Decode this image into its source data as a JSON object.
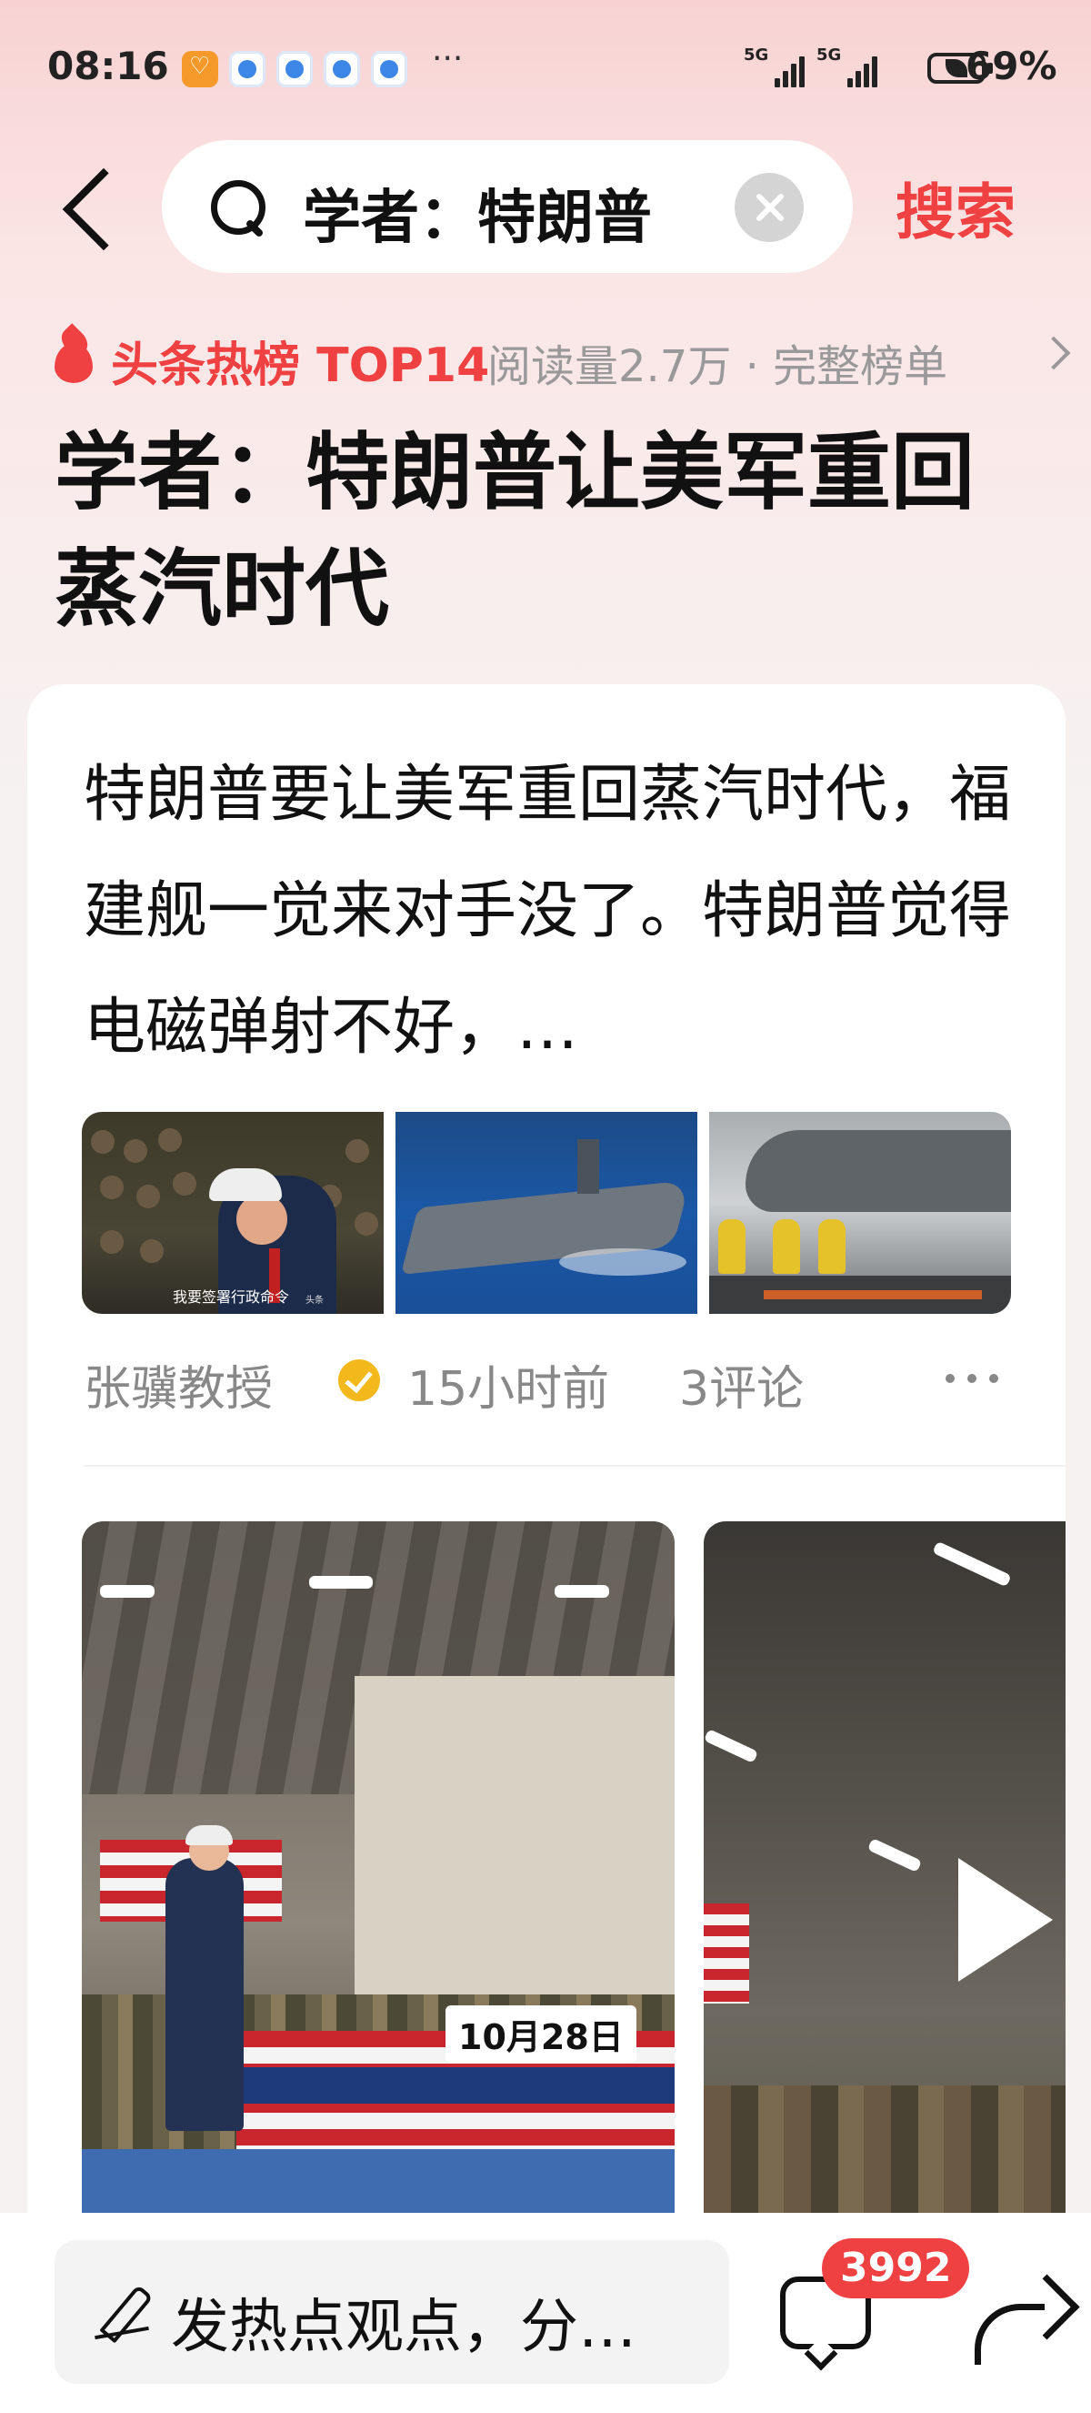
{
  "status_bar": {
    "time": "08:16",
    "network_1": "5G",
    "network_2": "5G",
    "battery_percent": "69%",
    "more": "···"
  },
  "search": {
    "query": "学者：特朗普",
    "button_label": "搜索"
  },
  "hot_list": {
    "badge": "头条热榜 TOP14",
    "meta": "阅读量2.7万 · 完整榜单"
  },
  "topic": {
    "title": "学者：特朗普让美军重回蒸汽时代"
  },
  "article": {
    "text": "特朗普要让美军重回蒸汽时代，福建舰一觉来对手没了。特朗普觉得电磁弹射不好，…",
    "thumb1_caption": "我要签署行政命令",
    "thumb1_watermark": "头条",
    "author": "张骥教授",
    "time": "15小时前",
    "comments": "3评论"
  },
  "videos": {
    "video1_date_label": "10月28日"
  },
  "bottom_bar": {
    "comment_placeholder": "发热点观点，分…",
    "comment_count_badge": "3992"
  },
  "colors": {
    "accent": "#f04142",
    "verified": "#f2b81c"
  }
}
